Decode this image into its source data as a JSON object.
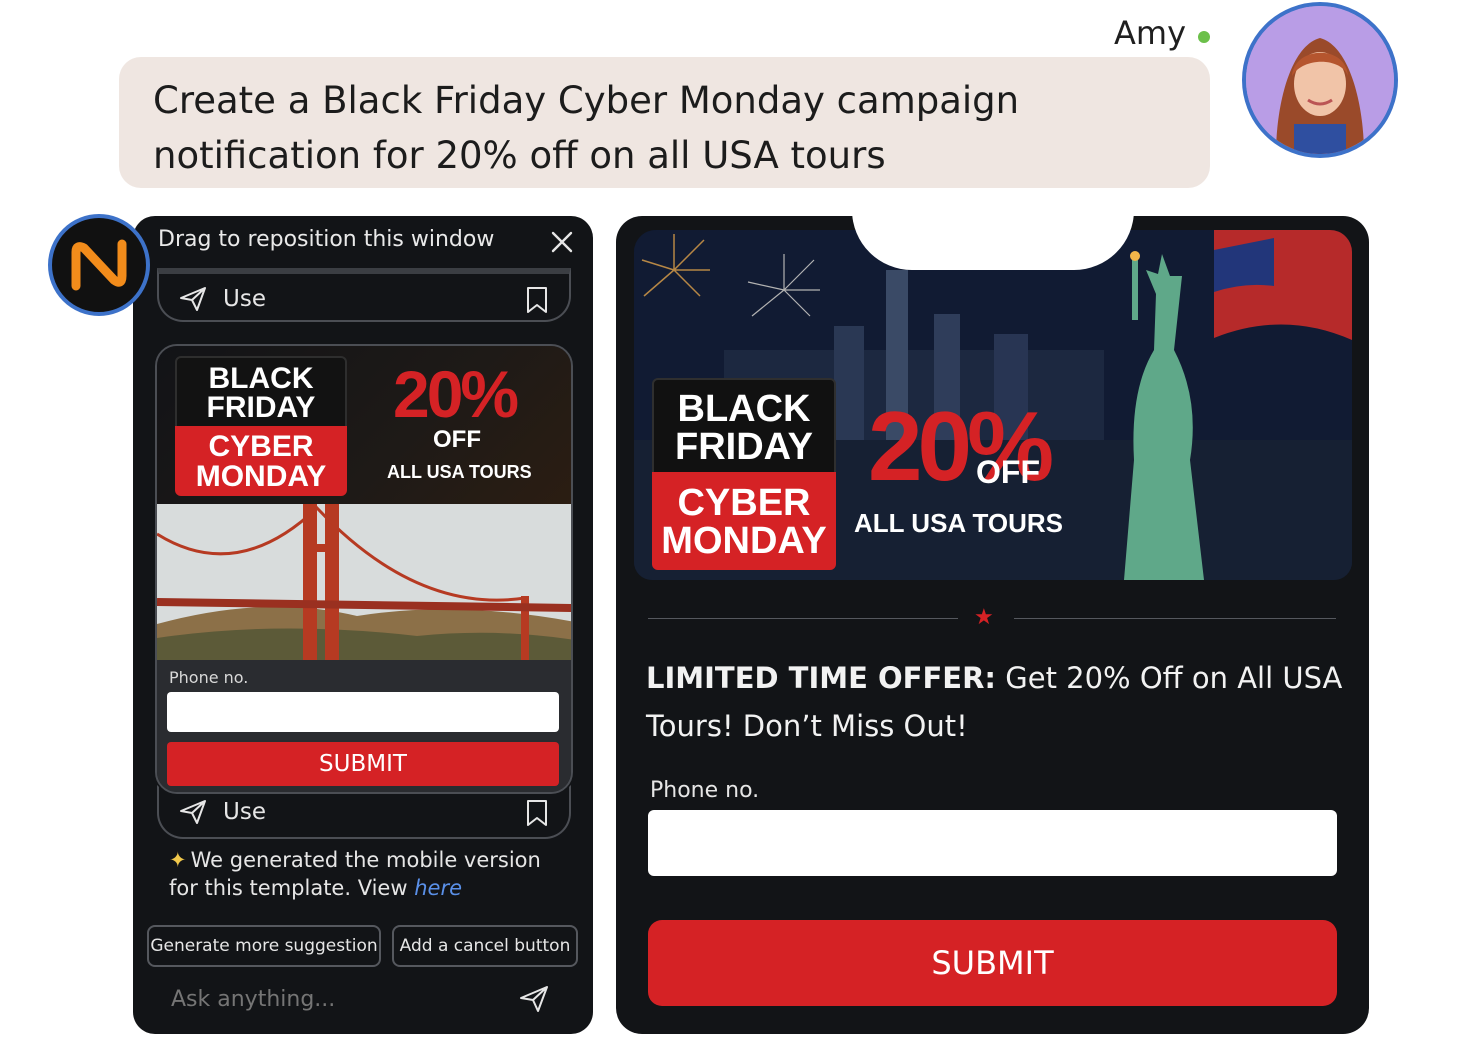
{
  "user": {
    "name": "Amy",
    "status": "online"
  },
  "prompt": {
    "line1": "Create a Black Friday Cyber Monday campaign",
    "line2": "notification for 20% off on all USA tours"
  },
  "assistant": {
    "title": "Drag to reposition this window",
    "use_label": "Use",
    "notice_text": "We generated the mobile version for this template. View",
    "notice_link": "here",
    "suggestions": [
      "Generate more suggestion",
      "Add a cancel button"
    ],
    "ask_placeholder": "Ask anything..."
  },
  "mini_template": {
    "badge_line1": "BLACK",
    "badge_line2": "FRIDAY",
    "badge_line3": "CYBER",
    "badge_line4": "MONDAY",
    "discount": "20%",
    "off": "OFF",
    "tours": "ALL USA TOURS",
    "phone_label": "Phone no.",
    "submit": "SUBMIT"
  },
  "preview": {
    "badge_line1": "BLACK",
    "badge_line2": "FRIDAY",
    "badge_line3": "CYBER",
    "badge_line4": "MONDAY",
    "discount": "20%",
    "off": "OFF",
    "tours": "ALL USA TOURS",
    "offer_bold": "LIMITED TIME OFFER:",
    "offer_text": " Get 20% Off on All USA Tours! Don’t Miss Out!",
    "phone_label": "Phone no.",
    "submit": "SUBMIT"
  },
  "colors": {
    "accent": "#d52225",
    "panel": "#121417",
    "link": "#5a90e8",
    "bubble": "#efe6e1"
  },
  "icons": [
    "close-icon",
    "send-icon",
    "bookmark-icon",
    "sparkle-icon",
    "star-icon",
    "logo-icon"
  ]
}
